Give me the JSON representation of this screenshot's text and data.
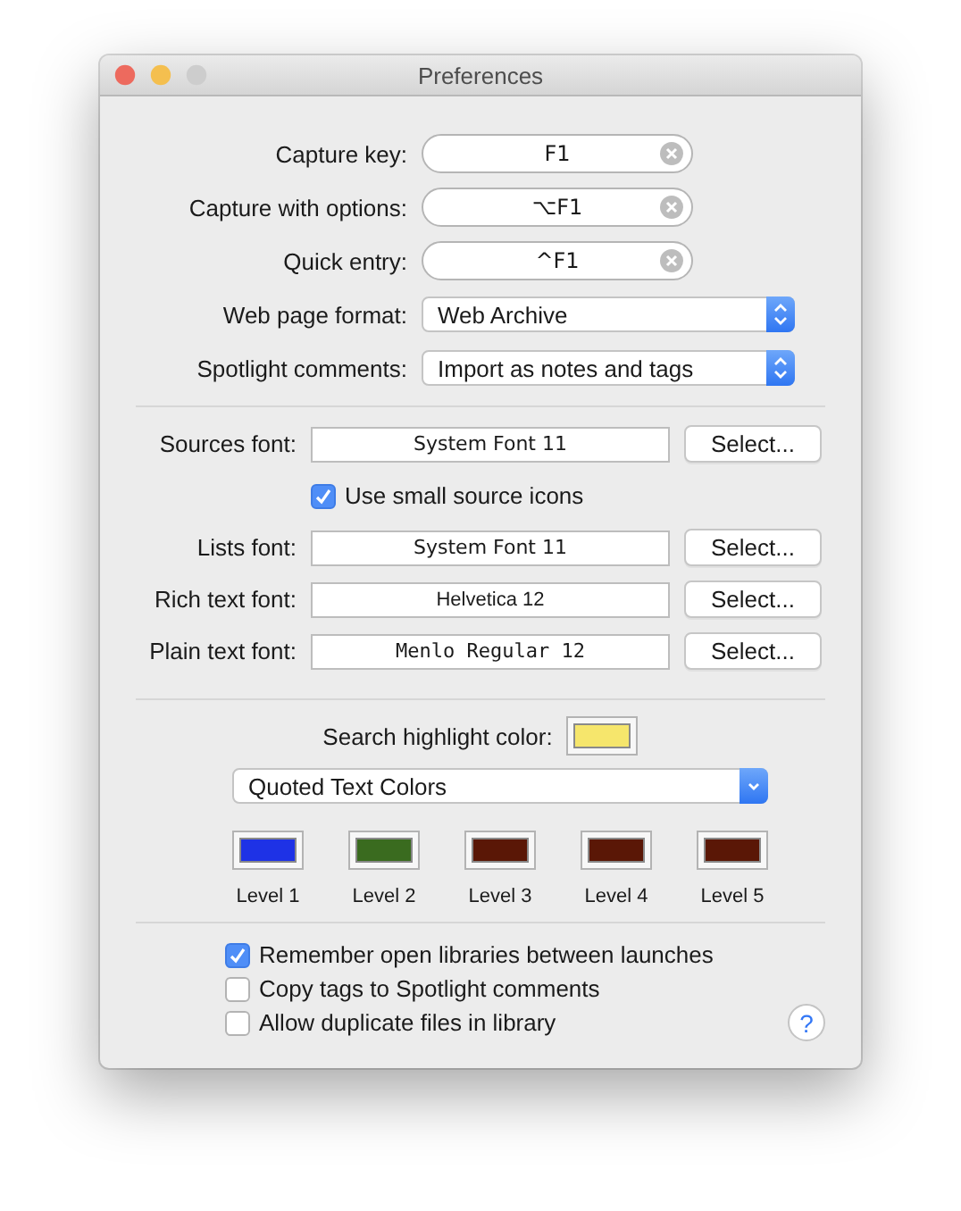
{
  "window": {
    "title": "Preferences",
    "controls": [
      {
        "kind": "close",
        "disabled": false
      },
      {
        "kind": "minimize",
        "disabled": false
      },
      {
        "kind": "zoom",
        "disabled": true
      }
    ]
  },
  "shortcuts": [
    {
      "label": "Capture key:",
      "value": "F1"
    },
    {
      "label": "Capture with options:",
      "value": "⌥F1"
    },
    {
      "label": "Quick entry:",
      "value": "^F1"
    }
  ],
  "popups": [
    {
      "label": "Web page format:",
      "value": "Web Archive"
    },
    {
      "label": "Spotlight comments:",
      "value": "Import as notes and tags"
    }
  ],
  "fonts": [
    {
      "kind": "system_font",
      "label": "Sources font:",
      "value": "System Font 11",
      "button": "Select..."
    },
    {
      "kind": "checkbox",
      "label": "Use small source icons",
      "checked": true
    },
    {
      "kind": "system_font",
      "label": "Lists font:",
      "value": "System Font 11",
      "button": "Select..."
    },
    {
      "kind": "sans_font",
      "label": "Rich text font:",
      "value": "Helvetica 12",
      "button": "Select..."
    },
    {
      "kind": "mono_font",
      "label": "Plain text font:",
      "value": "Menlo Regular 12",
      "button": "Select..."
    }
  ],
  "highlight": {
    "label": "Search highlight color:",
    "color": "#f6e66c"
  },
  "quote_popup": {
    "value": "Quoted Text Colors"
  },
  "levels": [
    {
      "label": "Level 1",
      "color": "#1e32e6"
    },
    {
      "label": "Level 2",
      "color": "#3a6b1f"
    },
    {
      "label": "Level 3",
      "color": "#5a1706"
    },
    {
      "label": "Level 4",
      "color": "#5a1706"
    },
    {
      "label": "Level 5",
      "color": "#5a1706"
    }
  ],
  "options": [
    {
      "label": "Remember open libraries between launches",
      "checked": true
    },
    {
      "label": "Copy tags to Spotlight comments",
      "checked": false
    },
    {
      "label": "Allow duplicate files in library",
      "checked": false
    }
  ],
  "help": {
    "symbol": "?"
  }
}
